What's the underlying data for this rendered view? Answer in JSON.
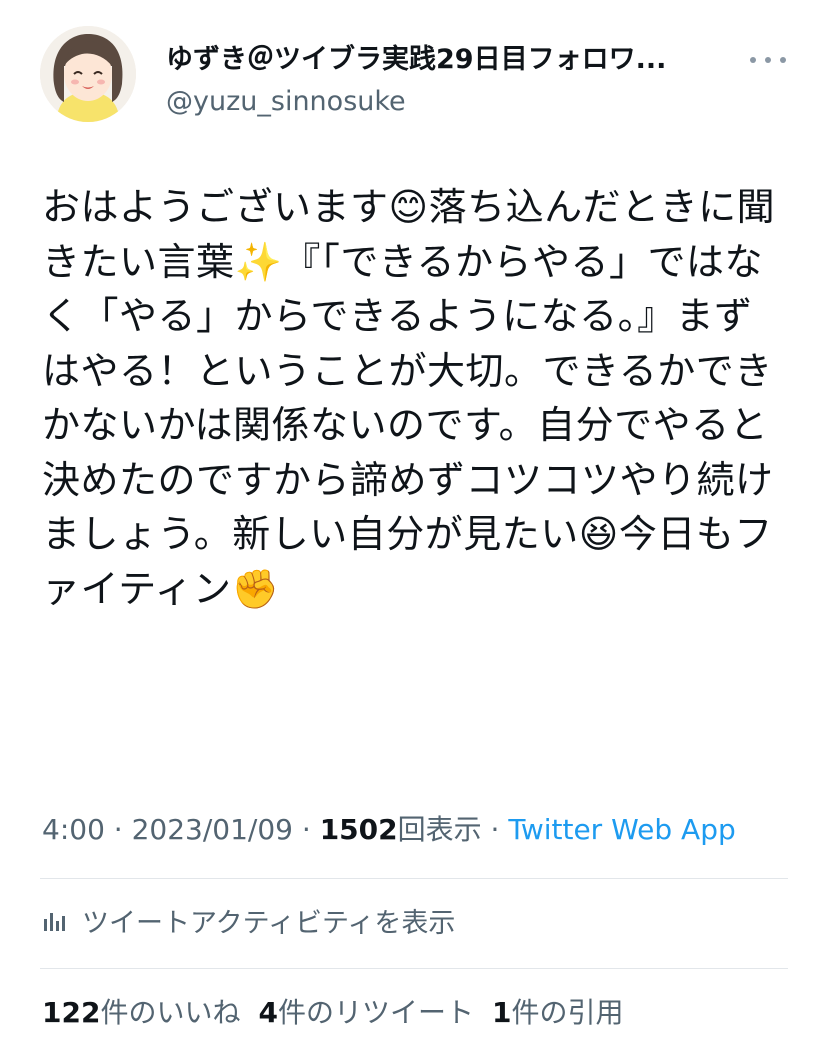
{
  "author": {
    "display_name": "ゆずき＠ツイブラ実践29日目フォロワ...",
    "handle": "@yuzu_sinnosuke"
  },
  "tweet": {
    "text": "おはようございます😊落ち込んだときに聞きたい言葉✨『「できるからやる」ではなく「やる」からできるようになる。』まずはやる！ということが大切。できるかできかないかは関係ないのです。自分でやると決めたのですから諦めずコツコツやり続けましょう。新しい自分が見たい😆今日もファイティン✊"
  },
  "meta": {
    "time": "4:00",
    "sep1": " · ",
    "date": "2023/01/09",
    "sep2": " · ",
    "views_count": "1502",
    "views_label": "回表示",
    "sep3": " · ",
    "source": "Twitter Web App"
  },
  "activity": {
    "label": "ツイートアクティビティを表示",
    "icon": "analytics-icon"
  },
  "stats": {
    "likes_count": "122",
    "likes_label": "件のいいね",
    "retweets_count": "4",
    "retweets_label": "件のリツイート",
    "quotes_count": "1",
    "quotes_label": "件の引用"
  },
  "colors": {
    "text": "#0f1419",
    "secondary": "#536471",
    "link": "#1d9bf0",
    "divider": "#e2e6ea"
  }
}
